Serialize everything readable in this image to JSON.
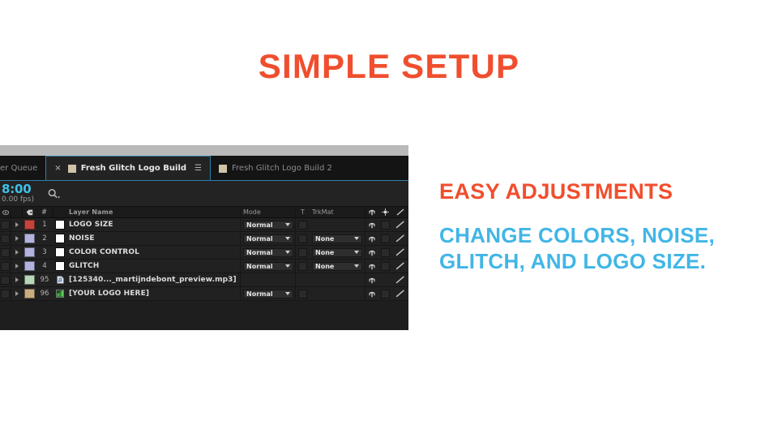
{
  "slide": {
    "title": "SIMPLE SETUP",
    "subhead": "EASY ADJUSTMENTS",
    "body": "CHANGE COLORS, NOISE, GLITCH, AND LOGO SIZE.",
    "colors": {
      "accent_orange": "#f04e2e",
      "accent_blue": "#41b6e6",
      "background": "#ffffff"
    }
  },
  "ae_panel": {
    "tabs": [
      {
        "label": "er Queue",
        "active": false,
        "has_close": false,
        "has_chip": false,
        "has_menu": false
      },
      {
        "label": "Fresh Glitch Logo Build",
        "active": true,
        "has_close": true,
        "has_chip": true,
        "has_menu": true,
        "close_label": "×",
        "menu_label": "☰"
      },
      {
        "label": "Fresh Glitch Logo Build 2",
        "active": false,
        "has_close": false,
        "has_chip": true,
        "has_menu": false
      }
    ],
    "timecode": {
      "current": "8:00",
      "fps": "0.00 fps)",
      "search_icon": "search-icon",
      "search_placeholder": ""
    },
    "columns": {
      "tag": "tag-icon",
      "number": "#",
      "layer_name": "Layer Name",
      "mode": "Mode",
      "t": "T",
      "trkmat": "TrkMat",
      "parent_icon": "parent-icon",
      "shy_icon": "shy-icon",
      "pick_icon": "pickwhip-icon"
    },
    "layers": [
      {
        "index": "1",
        "name": "LOGO SIZE",
        "color": "#c4443c",
        "mode": "Normal",
        "trkmat": "",
        "source_icon": "solid-icon",
        "has_mode": true,
        "has_trkmat": false,
        "has_t": true
      },
      {
        "index": "2",
        "name": "NOISE",
        "color": "#b3b3e0",
        "mode": "Normal",
        "trkmat": "None",
        "source_icon": "solid-icon",
        "has_mode": true,
        "has_trkmat": true,
        "has_t": true
      },
      {
        "index": "3",
        "name": "COLOR CONTROL",
        "color": "#b3b3e0",
        "mode": "Normal",
        "trkmat": "None",
        "source_icon": "solid-icon",
        "has_mode": true,
        "has_trkmat": true,
        "has_t": true
      },
      {
        "index": "4",
        "name": "GLITCH",
        "color": "#b3b3e0",
        "mode": "Normal",
        "trkmat": "None",
        "source_icon": "solid-icon",
        "has_mode": true,
        "has_trkmat": true,
        "has_t": true
      },
      {
        "index": "95",
        "name": "[125340..._martijndebont_preview.mp3]",
        "color": "#b9d6b9",
        "mode": "",
        "trkmat": "",
        "source_icon": "audio-icon",
        "has_mode": false,
        "has_trkmat": false,
        "has_t": false
      },
      {
        "index": "96",
        "name": "[YOUR LOGO HERE]",
        "color": "#c9ad80",
        "mode": "Normal",
        "trkmat": "",
        "source_icon": "image-icon",
        "has_mode": true,
        "has_trkmat": false,
        "has_t": true
      }
    ],
    "dropdown_caret": "chevron-down-icon",
    "expand_triangle": "expand-triangle-icon"
  }
}
